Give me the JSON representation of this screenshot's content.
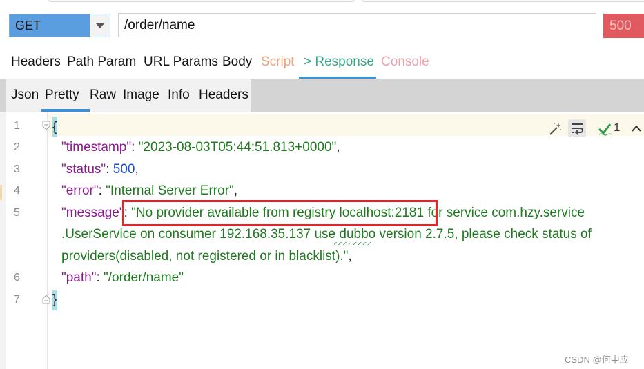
{
  "request": {
    "method": "GET",
    "url": "/order/name",
    "status_code": "500"
  },
  "main_tabs": [
    "Headers",
    "Path Param",
    "URL Params",
    "Body",
    "Script",
    "> Response",
    "Console"
  ],
  "sub_tabs": [
    "Json",
    "Pretty",
    "Raw",
    "Image",
    "Info",
    "Headers"
  ],
  "editor": {
    "line_numbers": [
      "1",
      "2",
      "3",
      "4",
      "5",
      "6",
      "7"
    ],
    "lines": {
      "open_brace": "{",
      "timestamp_key": "\"timestamp\"",
      "timestamp_val": "\"2023-08-03T05:44:51.813+0000\"",
      "status_key": "\"status\"",
      "status_val": "500",
      "error_key": "\"error\"",
      "error_val": "\"Internal Server Error\"",
      "message_key": "\"message\"",
      "message_val_1": "\"No provider available from registry localhost:2181 for service com.hzy.service",
      "message_val_2": ".UserService on consumer 192.168.35.137 use dubbo version 2.7.5, please check status of",
      "message_val_3": "providers(disabled, not registered or in blacklist).\"",
      "path_key": "\"path\"",
      "path_val": "\"/order/name\"",
      "close_brace": "}"
    },
    "sep_colon": ": ",
    "sep_comma": ",",
    "match_count": "1",
    "icons": [
      "magic-wand-icon",
      "wrap-lines-icon",
      "check-icon",
      "chevron-up-icon"
    ]
  },
  "watermark": "CSDN @何中应",
  "colors": {
    "method_bg": "#5b9ee0",
    "status_bg": "#e05a5f",
    "response_tab": "#3aa883",
    "script_tab": "#f0a27d",
    "console_tab": "#f0a0ae",
    "key": "#8b1a8e",
    "string": "#1f7a1f",
    "number": "#1b4fd1",
    "highlight_box": "#e0252b"
  }
}
